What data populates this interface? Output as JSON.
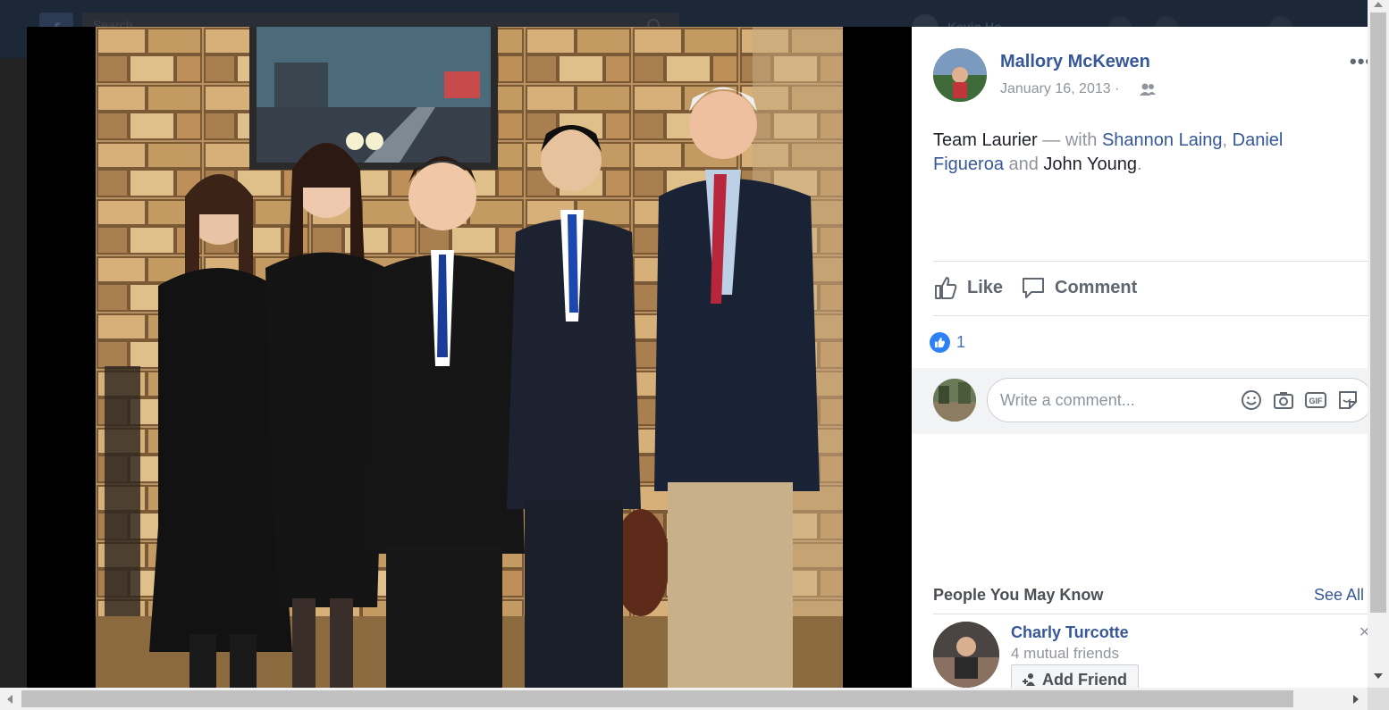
{
  "header": {
    "logo": "f",
    "search_placeholder": "Search",
    "user_name": "Kevin  Ho..."
  },
  "post": {
    "author": "Mallory McKewen",
    "date": "January 16, 2013 ·",
    "audience_icon": "friends-icon",
    "more": "•••",
    "caption": {
      "text": "Team Laurier",
      "with_sep": " — with ",
      "tag1": "Shannon Laing",
      "comma": ", ",
      "tag2": "Daniel Figueroa",
      "and": " and ",
      "tag3": "John Young",
      "period": "."
    }
  },
  "actions": {
    "like": "Like",
    "comment": "Comment"
  },
  "reactions": {
    "count": "1",
    "color": "#2e81f4"
  },
  "comment_box": {
    "placeholder": "Write a comment...",
    "icons": [
      "emoji-icon",
      "camera-icon",
      "gif-icon",
      "sticker-icon"
    ],
    "gif_label": "GIF"
  },
  "pymk": {
    "title": "People You May Know",
    "see_all": "See All",
    "person": {
      "name": "Charly Turcotte",
      "mutual": "4 mutual friends",
      "button": "Add Friend"
    }
  },
  "colors": {
    "link": "#365899",
    "muted": "#90949c",
    "text": "#1d2129"
  }
}
